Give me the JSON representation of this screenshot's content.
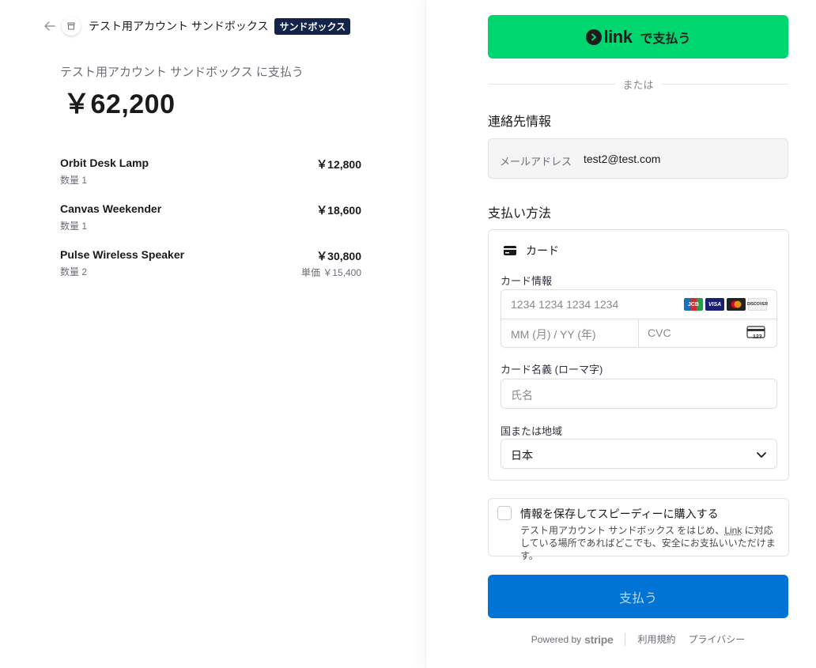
{
  "header": {
    "merchant_name": "テスト用アカウント サンドボックス",
    "sandbox_badge": "サンドボックス"
  },
  "summary": {
    "pay_to": "テスト用アカウント サンドボックス に支払う",
    "total": "￥62,200"
  },
  "items": [
    {
      "name": "Orbit Desk Lamp",
      "qty": "数量 1",
      "price": "￥12,800"
    },
    {
      "name": "Canvas Weekender",
      "qty": "数量 1",
      "price": "￥18,600"
    },
    {
      "name": "Pulse Wireless Speaker",
      "qty": "数量 2",
      "price": "￥30,800",
      "unit_price": "単価 ￥15,400"
    }
  ],
  "link_button": {
    "brand": "link",
    "label": "で支払う"
  },
  "divider_text": "または",
  "contact": {
    "title": "連絡先情報",
    "email_label": "メールアドレス",
    "email_value": "test2@test.com"
  },
  "payment": {
    "title": "支払い方法",
    "method_label": "カード",
    "card_info_label": "カード情報",
    "card_number_placeholder": "1234 1234 1234 1234",
    "expiry_placeholder": "MM (月) / YY (年)",
    "cvc_placeholder": "CVC",
    "card_brands": [
      "JCB",
      "VISA",
      "Mastercard",
      "DISCOVER"
    ],
    "cardholder_label": "カード名義 (ローマ字)",
    "cardholder_placeholder": "氏名",
    "country_label": "国または地域",
    "country_value": "日本"
  },
  "save_info": {
    "title": "情報を保存してスピーディーに購入する",
    "desc_prefix": "テスト用アカウント サンドボックス をはじめ、",
    "desc_link": "Link",
    "desc_suffix": " に対応している場所であればどこでも、安全にお支払いいただけます。"
  },
  "pay_button": {
    "label": "支払う"
  },
  "footer": {
    "powered_by": "Powered by",
    "stripe": "stripe",
    "terms": "利用規約",
    "privacy": "プライバシー"
  },
  "colors": {
    "link_green": "#00d66f",
    "pay_blue": "#0074d4",
    "badge_navy": "#14234a"
  }
}
